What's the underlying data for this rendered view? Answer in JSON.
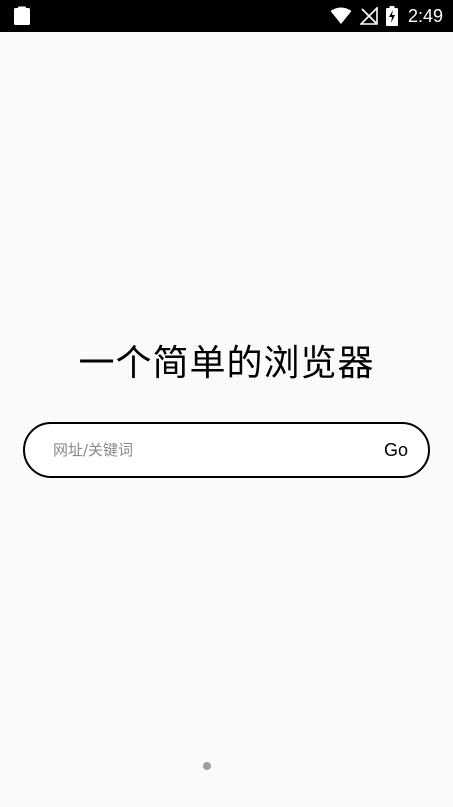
{
  "status_bar": {
    "time": "2:49",
    "left_icon": "clipboard-icon",
    "icons": [
      "wifi-icon",
      "signal-off-icon",
      "battery-charging-icon"
    ],
    "background_color": "#000000"
  },
  "main": {
    "title": "一个简单的浏览器",
    "search": {
      "placeholder": "网址/关键词",
      "value": "",
      "go_label": "Go"
    }
  },
  "pager": {
    "page_count": 1,
    "current_page": 1
  },
  "colors": {
    "background": "#fafafa",
    "text": "#000000",
    "placeholder": "#8a8a8a",
    "indicator": "#9e9e9e"
  }
}
